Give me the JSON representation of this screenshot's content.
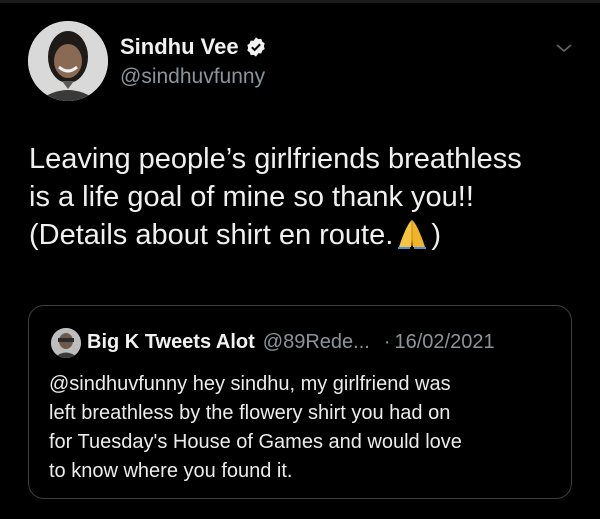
{
  "tweet": {
    "author": {
      "display_name": "Sindhu Vee",
      "handle": "@sindhuvfunny",
      "verified": true
    },
    "text_lines": [
      "Leaving people’s girlfriends breathless",
      "is a life goal of mine so thank you!!",
      "(Details about shirt en route.",
      ")"
    ],
    "emoji": "folded-hands",
    "menu_icon": "chevron-down-icon"
  },
  "quoted_tweet": {
    "author": {
      "display_name": "Big K Tweets Alot",
      "handle": "@89Rede...",
      "separator": "·",
      "date": "16/02/2021"
    },
    "text_lines": [
      "@sindhuvfunny hey sindhu, my girlfriend was",
      "left breathless by the flowery shirt you had on",
      "for Tuesday's House of Games and would love",
      "to know where you found it."
    ]
  },
  "colors": {
    "background": "#000000",
    "text": "#f0f0f0",
    "secondary_text": "#8b949a",
    "card_border": "#3d3d3d"
  }
}
